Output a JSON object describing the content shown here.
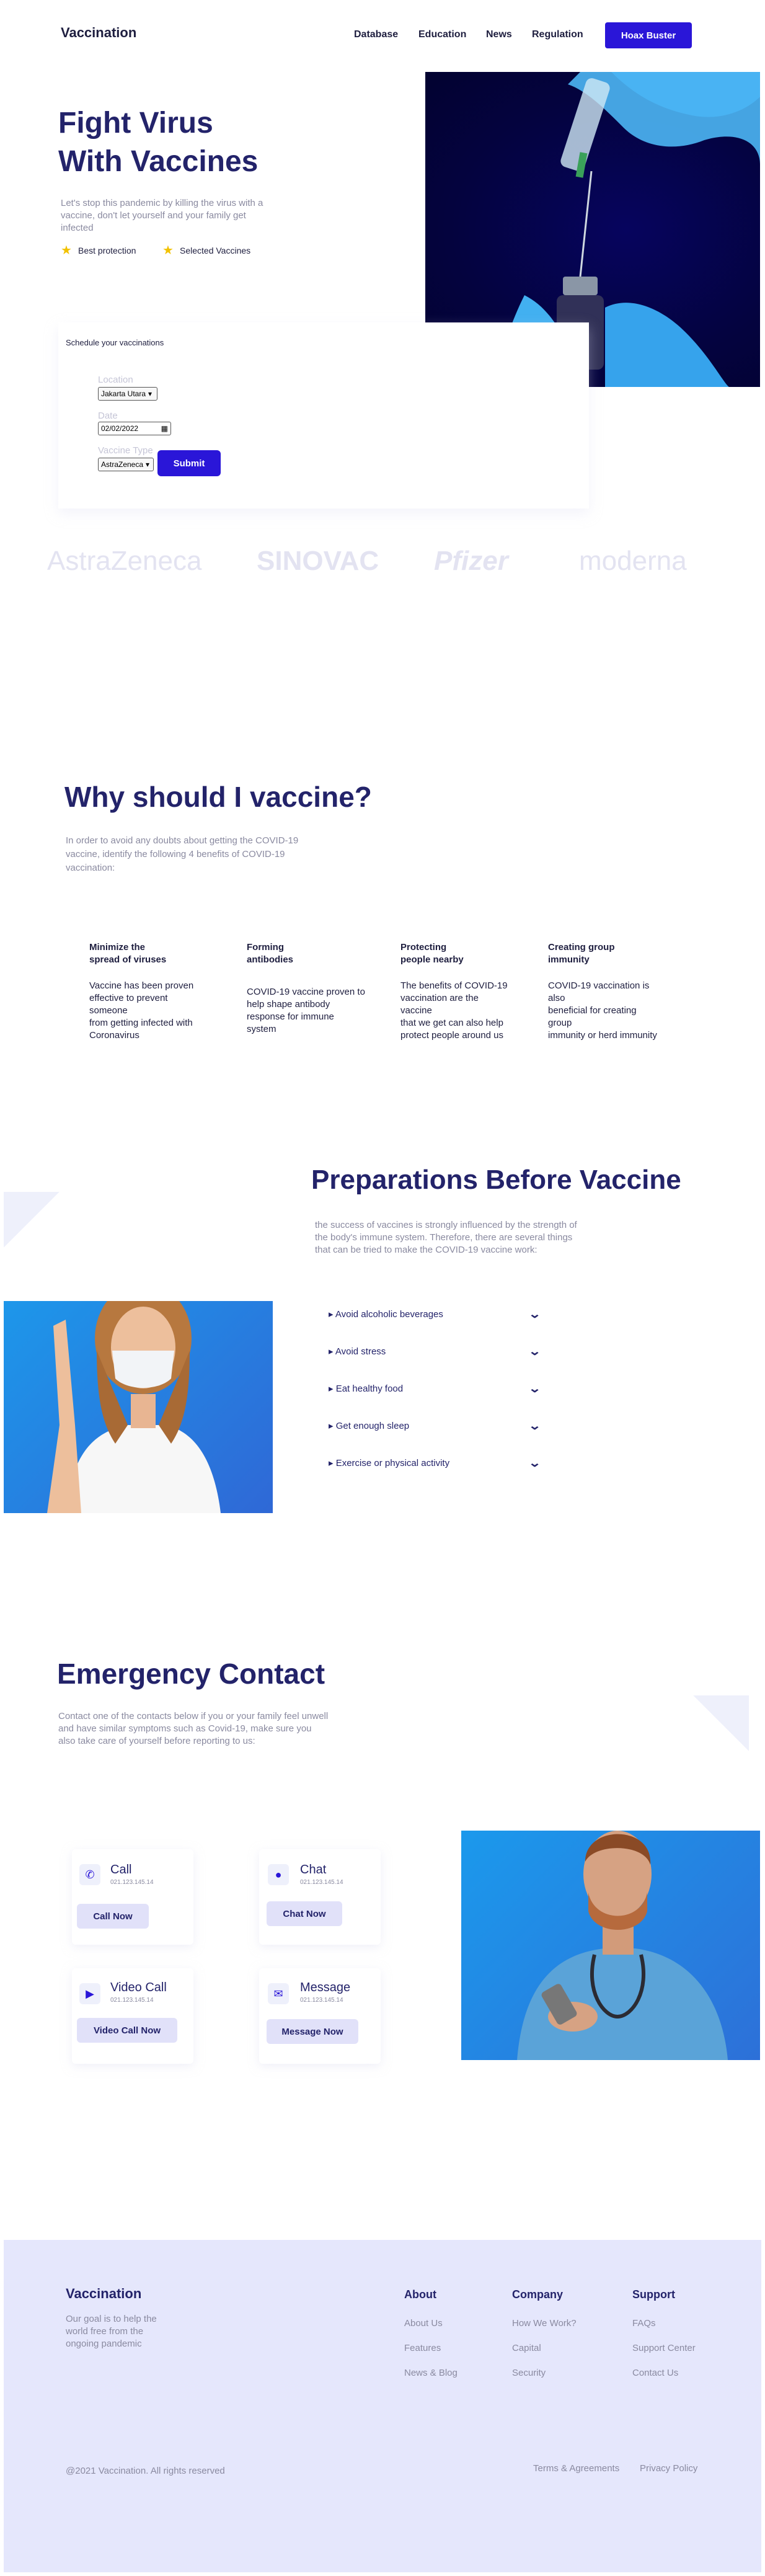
{
  "header": {
    "logo": "Vaccination",
    "nav": [
      "Database",
      "Education",
      "News",
      "Regulation"
    ],
    "cta_label": "Hoax Buster"
  },
  "hero": {
    "title_line1": "Fight Virus",
    "title_line2": "With Vaccines",
    "description": "Let's stop this pandemic by killing the virus with a vaccine, don't let yourself and your family get infected",
    "features": [
      "Best protection",
      "Selected Vaccines"
    ],
    "image_icon": "syringe-vial-photo"
  },
  "schedule": {
    "title": "Schedule your vaccinations",
    "location_label": "Location",
    "location_value": "Jakarta Utara",
    "date_label": "Date",
    "date_value": "02/02/2022",
    "type_label": "Vaccine Type",
    "type_value": "AstraZeneca",
    "submit_label": "Submit"
  },
  "brands": [
    "AstraZeneca",
    "SINOVAC",
    "Pfizer",
    "moderna"
  ],
  "why": {
    "title": "Why should I vaccine?",
    "description": "In order to avoid any doubts about getting the COVID-19 vaccine, identify the following 4 benefits of COVID-19 vaccination:",
    "benefits": [
      {
        "title": "Minimize the\nspread of viruses",
        "text": "Vaccine has been proven\neffective to prevent\nsomeone\nfrom getting infected with\nCoronavirus"
      },
      {
        "title": "Forming\nantibodies",
        "text": "COVID-19 vaccine proven to\nhelp shape antibody\nresponse for immune\nsystem"
      },
      {
        "title": "Protecting\npeople nearby",
        "text": "The benefits of COVID-19\nvaccination are the\nvaccine\nthat we get can also help\nprotect people around us"
      },
      {
        "title": "Creating group\nimmunity",
        "text": "COVID-19 vaccination is\nalso\nbeneficial for creating\ngroup\nimmunity or herd immunity"
      }
    ]
  },
  "prep": {
    "title": "Preparations Before Vaccine",
    "description": "the success of vaccines is strongly influenced by the strength of the body's immune system. Therefore, there are several things that can be tried to make the COVID-19 vaccine work:",
    "items": [
      "Avoid alcoholic beverages",
      "Avoid stress",
      "Eat healthy food",
      "Get enough sleep",
      "Exercise or physical activity"
    ]
  },
  "emergency": {
    "title": "Emergency Contact",
    "description": "Contact one of the contacts below if you or your family feel unwell and have similar symptoms such as Covid-19, make sure you also take care of yourself before reporting to us:",
    "contacts": [
      {
        "title": "Call",
        "number": "021.123.145.14",
        "button": "Call Now",
        "icon": "phone-icon"
      },
      {
        "title": "Chat",
        "number": "021.123.145.14",
        "button": "Chat Now",
        "icon": "chat-icon"
      },
      {
        "title": "Video Call",
        "number": "021.123.145.14",
        "button": "Video Call Now",
        "icon": "video-icon"
      },
      {
        "title": "Message",
        "number": "021.123.145.14",
        "button": "Message Now",
        "icon": "message-icon"
      }
    ]
  },
  "footer": {
    "logo": "Vaccination",
    "description": "Our goal is to help the world free from the ongoing pandemic",
    "columns": [
      {
        "heading": "About",
        "links": [
          "About Us",
          "Features",
          "News & Blog"
        ]
      },
      {
        "heading": "Company",
        "links": [
          "How We Work?",
          "Capital",
          "Security"
        ]
      },
      {
        "heading": "Support",
        "links": [
          "FAQs",
          "Support Center",
          "Contact Us"
        ]
      }
    ],
    "copyright": "@2021 Vaccination. All rights reserved",
    "legal": [
      "Terms & Agreements",
      "Privacy Policy"
    ]
  },
  "colors": {
    "primary": "#2a16d8",
    "heading": "#23236a",
    "footer_bg": "#e5e7fc"
  }
}
